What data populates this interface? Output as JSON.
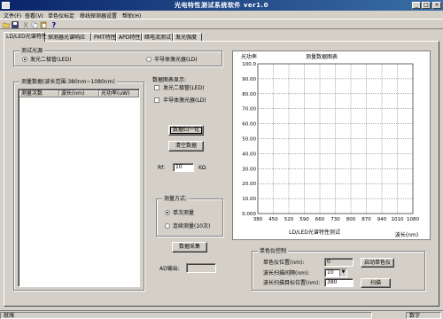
{
  "window": {
    "title": "光电特性测试系统软件 ver1.0",
    "controls": {
      "minimize": "_",
      "maximize": "□",
      "close": "×"
    }
  },
  "menu": [
    "文件(F)",
    "查看(V)",
    "单色仪标定",
    "移线探测器设置",
    "帮助(H)"
  ],
  "tabs": [
    "LD/LED光谱特性",
    "探测器光谱响应",
    "PMT特性",
    "APD特性",
    "暗电流测试",
    "发光强度"
  ],
  "active_tab": 0,
  "source_group": {
    "title": "测试光源",
    "options": [
      "发光二极管(LED)",
      "半导体激光器(LD)"
    ],
    "selected": 0
  },
  "data_group": {
    "title": "测量数据(波长范围:380nm~1080nm)",
    "columns": [
      "测量次数",
      "波长(nm)",
      "光功率(uW)"
    ]
  },
  "display_group": {
    "title": "数据图表显示:",
    "options": [
      "发光二极管(LED)",
      "半导体激光器(LD)"
    ]
  },
  "buttons": {
    "normalize": "数据归一化",
    "clear": "清空数据",
    "collect": "数据采集",
    "start_mono": "启动单色仪",
    "scan": "扫描"
  },
  "gain": {
    "label": "Rf:",
    "value": "10",
    "unit": "KΩ"
  },
  "measure_mode": {
    "title": "测量方式:",
    "options": [
      "单次测量",
      "连续测量(10次)"
    ],
    "selected": 0
  },
  "ad_output": {
    "label": "AD输出:",
    "value": ""
  },
  "mono": {
    "title": "单色仪控制",
    "position_label": "单色仪位置(nm):",
    "position_value": "0",
    "interval_label": "波长扫描间隔(nm):",
    "interval_value": "10",
    "target_label": "波长扫描目标位置(nm):",
    "target_value": "380"
  },
  "chart_data": {
    "type": "line",
    "title": "测量数据图表",
    "ylabel": "光功率",
    "xlabel": "波长(nm)",
    "xaxis_title": "LD/LED光谱特性测试",
    "x_ticks": [
      "380",
      "450",
      "520",
      "590",
      "660",
      "730",
      "800",
      "870",
      "940",
      "1010",
      "1080"
    ],
    "y_ticks": [
      "0.000",
      "10.00",
      "20.00",
      "30.00",
      "40.00",
      "50.00",
      "60.00",
      "70.00",
      "80.00",
      "90.00",
      "100.0"
    ],
    "xlim": [
      380,
      1080
    ],
    "ylim": [
      0,
      100
    ],
    "grid": true,
    "series": []
  },
  "status": {
    "left": "就绪",
    "right": "数字"
  },
  "colors": {
    "titlebar": "#0a246a",
    "face": "#d4d0c8"
  }
}
